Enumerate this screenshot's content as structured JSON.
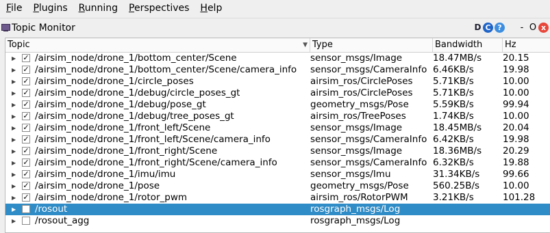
{
  "menubar": [
    {
      "name": "menu-file",
      "u": "F",
      "rest": "ile"
    },
    {
      "name": "menu-plugins",
      "u": "P",
      "rest": "lugins"
    },
    {
      "name": "menu-running",
      "u": "R",
      "rest": "unning"
    },
    {
      "name": "menu-perspectives",
      "u": "P",
      "rest": "erspectives"
    },
    {
      "name": "menu-help",
      "u": "H",
      "rest": "elp"
    }
  ],
  "window": {
    "title": "Topic Monitor",
    "buttons": {
      "d": "D",
      "reload": "C",
      "help": "?",
      "minimize": "-",
      "float": "O",
      "close": "x"
    }
  },
  "columns": {
    "topic": "Topic",
    "type": "Type",
    "bandwidth": "Bandwidth",
    "hz": "Hz"
  },
  "rows": [
    {
      "checked": true,
      "topic": "/airsim_node/drone_1/bottom_center/Scene",
      "type": "sensor_msgs/Image",
      "bandwidth": "18.47MB/s",
      "hz": "20.15"
    },
    {
      "checked": true,
      "topic": "/airsim_node/drone_1/bottom_center/Scene/camera_info",
      "type": "sensor_msgs/CameraInfo",
      "bandwidth": "6.46KB/s",
      "hz": "19.98"
    },
    {
      "checked": true,
      "topic": "/airsim_node/drone_1/circle_poses",
      "type": "airsim_ros/CirclePoses",
      "bandwidth": "5.71KB/s",
      "hz": "10.00"
    },
    {
      "checked": true,
      "topic": "/airsim_node/drone_1/debug/circle_poses_gt",
      "type": "airsim_ros/CirclePoses",
      "bandwidth": "5.71KB/s",
      "hz": "10.00"
    },
    {
      "checked": true,
      "topic": "/airsim_node/drone_1/debug/pose_gt",
      "type": "geometry_msgs/Pose",
      "bandwidth": "5.59KB/s",
      "hz": "99.94"
    },
    {
      "checked": true,
      "topic": "/airsim_node/drone_1/debug/tree_poses_gt",
      "type": "airsim_ros/TreePoses",
      "bandwidth": "1.74KB/s",
      "hz": "10.00"
    },
    {
      "checked": true,
      "topic": "/airsim_node/drone_1/front_left/Scene",
      "type": "sensor_msgs/Image",
      "bandwidth": "18.45MB/s",
      "hz": "20.04"
    },
    {
      "checked": true,
      "topic": "/airsim_node/drone_1/front_left/Scene/camera_info",
      "type": "sensor_msgs/CameraInfo",
      "bandwidth": "6.42KB/s",
      "hz": "19.98"
    },
    {
      "checked": true,
      "topic": "/airsim_node/drone_1/front_right/Scene",
      "type": "sensor_msgs/Image",
      "bandwidth": "18.36MB/s",
      "hz": "20.29"
    },
    {
      "checked": true,
      "topic": "/airsim_node/drone_1/front_right/Scene/camera_info",
      "type": "sensor_msgs/CameraInfo",
      "bandwidth": "6.32KB/s",
      "hz": "19.88"
    },
    {
      "checked": true,
      "topic": "/airsim_node/drone_1/imu/imu",
      "type": "sensor_msgs/Imu",
      "bandwidth": "31.34KB/s",
      "hz": "99.66"
    },
    {
      "checked": true,
      "topic": "/airsim_node/drone_1/pose",
      "type": "geometry_msgs/Pose",
      "bandwidth": "560.25B/s",
      "hz": "10.00"
    },
    {
      "checked": true,
      "topic": "/airsim_node/drone_1/rotor_pwm",
      "type": "airsim_ros/RotorPWM",
      "bandwidth": "3.21KB/s",
      "hz": "101.28"
    },
    {
      "checked": false,
      "selected": true,
      "topic": "/rosout",
      "type": "rosgraph_msgs/Log",
      "bandwidth": "",
      "hz": ""
    },
    {
      "checked": false,
      "topic": "/rosout_agg",
      "type": "rosgraph_msgs/Log",
      "bandwidth": "",
      "hz": ""
    }
  ],
  "glyphs": {
    "expander": "▶",
    "check": "✓",
    "sort": "▼"
  },
  "colors": {
    "selection": "#308cc6",
    "close": "#e8463a",
    "reload": "#1f64c8",
    "help": "#3d8ee0"
  }
}
